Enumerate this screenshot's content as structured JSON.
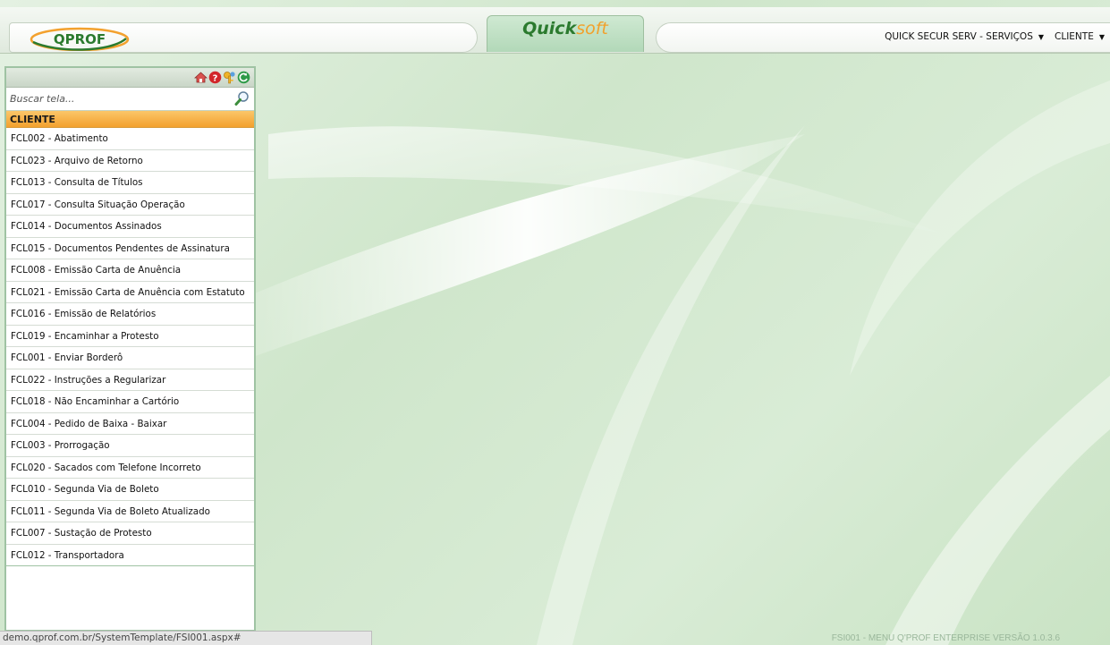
{
  "header": {
    "logo_text": "QPROF",
    "brand_part1": "Quick",
    "brand_part2": "soft",
    "menu": [
      {
        "label": "QUICK SECUR SERV - SERVIÇOS"
      },
      {
        "label": "CLIENTE"
      }
    ]
  },
  "sidebar": {
    "search_placeholder": "Buscar tela...",
    "group_title": "CLIENTE",
    "items": [
      {
        "label": "FCL002 - Abatimento"
      },
      {
        "label": "FCL023 - Arquivo de Retorno"
      },
      {
        "label": "FCL013 - Consulta de Títulos"
      },
      {
        "label": "FCL017 - Consulta Situação Operação"
      },
      {
        "label": "FCL014 - Documentos Assinados"
      },
      {
        "label": "FCL015 - Documentos Pendentes de Assinatura"
      },
      {
        "label": "FCL008 - Emissão Carta de Anuência"
      },
      {
        "label": "FCL021 - Emissão Carta de Anuência com Estatuto"
      },
      {
        "label": "FCL016 - Emissão de Relatórios"
      },
      {
        "label": "FCL019 - Encaminhar a Protesto"
      },
      {
        "label": "FCL001 - Enviar Borderô"
      },
      {
        "label": "FCL022 - Instruções a Regularizar"
      },
      {
        "label": "FCL018 - Não Encaminhar a Cartório"
      },
      {
        "label": "FCL004 - Pedido de Baixa - Baixar"
      },
      {
        "label": "FCL003 - Prorrogação"
      },
      {
        "label": "FCL020 - Sacados com Telefone Incorreto"
      },
      {
        "label": "FCL010 - Segunda Via de Boleto"
      },
      {
        "label": "FCL011 - Segunda Via de Boleto Atualizado"
      },
      {
        "label": "FCL007 - Sustação de Protesto"
      },
      {
        "label": "FCL012 - Transportadora"
      }
    ]
  },
  "status_url": "demo.qprof.com.br/SystemTemplate/FSI001.aspx#",
  "footer_version": "FSI001 - MENU Q'PROF ENTERPRISE VERSÃO 1.0.3.6",
  "colors": {
    "accent_orange": "#f3a12e",
    "brand_green": "#2b7a2e",
    "border_green": "#9fc3a3"
  },
  "icons": [
    "home-icon",
    "help-icon",
    "key-icon",
    "refresh-icon",
    "search-icon",
    "chevron-down-icon"
  ]
}
